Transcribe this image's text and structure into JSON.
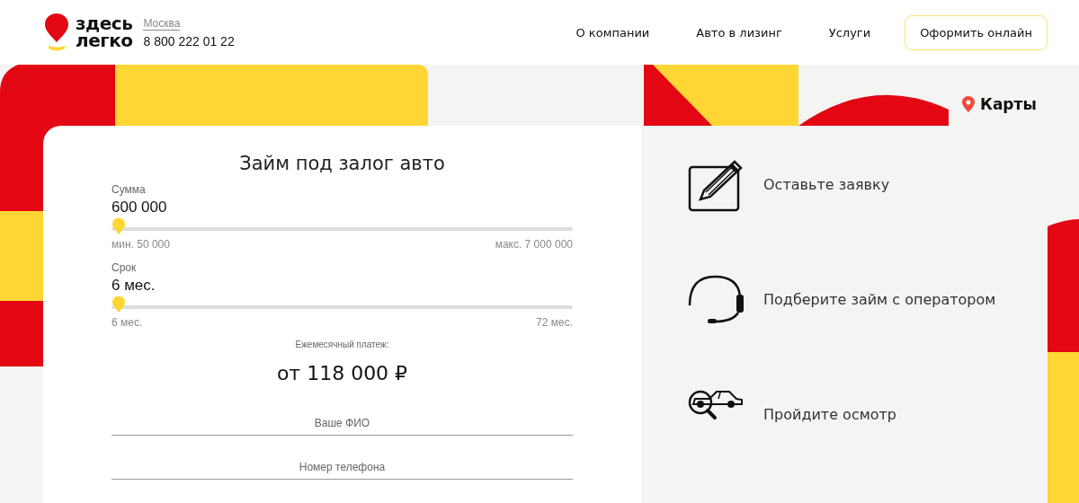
{
  "header": {
    "logo_text": [
      "здесь",
      "легко"
    ],
    "city": "Москва",
    "phone": "8 800 222 01 22",
    "nav": [
      "О компании",
      "Авто в лизинг",
      "Услуги"
    ],
    "cta": "Оформить онлайн"
  },
  "maps_link": "Карты",
  "calculator": {
    "title": "Займ под залог авто",
    "sliders": [
      {
        "label": "Сумма",
        "value": "600 000",
        "level": 0,
        "min": "мин. 50 000",
        "max": "макс. 7 000 000"
      },
      {
        "label": "Срок",
        "value": "6 мес.",
        "level": 0,
        "min": "6 мес.",
        "max": "72 мес."
      }
    ],
    "payment_label": "Ежемесячный платеж:",
    "payment": "от 118 000 ₽",
    "fields": [
      {
        "placeholder": "Ваше ФИО"
      },
      {
        "placeholder": "Номер телефона"
      }
    ]
  },
  "steps": [
    {
      "kind": "form",
      "text": "Оставьте заявку"
    },
    {
      "kind": "operator",
      "text": "Подберите займ с оператором"
    },
    {
      "kind": "inspection",
      "text": "Пройдите осмотр"
    }
  ]
}
